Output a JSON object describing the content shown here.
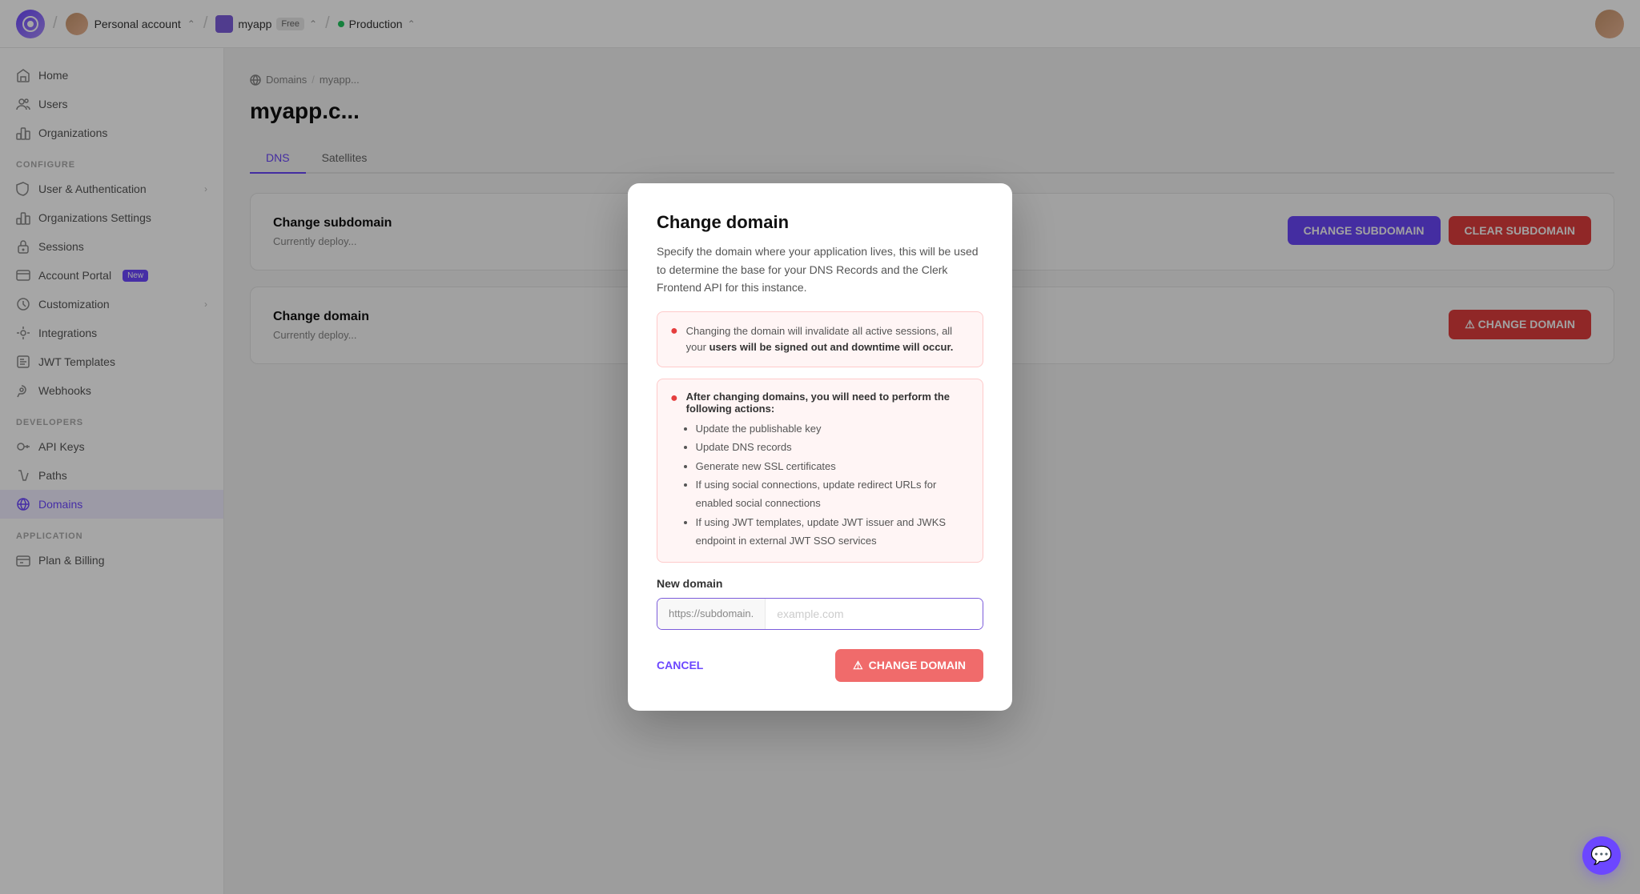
{
  "topbar": {
    "logo_letter": "C",
    "account_name": "Personal account",
    "app_name": "myapp",
    "app_badge": "Free",
    "env_name": "Production"
  },
  "sidebar": {
    "sections": [
      {
        "items": [
          {
            "id": "home",
            "label": "Home",
            "icon": "home"
          },
          {
            "id": "users",
            "label": "Users",
            "icon": "users"
          },
          {
            "id": "organizations",
            "label": "Organizations",
            "icon": "org"
          }
        ]
      },
      {
        "section_label": "Configure",
        "items": [
          {
            "id": "user-auth",
            "label": "User & Authentication",
            "icon": "shield",
            "has_chevron": true
          },
          {
            "id": "org-settings",
            "label": "Organizations Settings",
            "icon": "org-settings"
          },
          {
            "id": "sessions",
            "label": "Sessions",
            "icon": "lock"
          },
          {
            "id": "account-portal",
            "label": "Account Portal",
            "icon": "account-portal",
            "badge": "New"
          },
          {
            "id": "customization",
            "label": "Customization",
            "icon": "customization",
            "has_chevron": true
          },
          {
            "id": "integrations",
            "label": "Integrations",
            "icon": "integrations"
          },
          {
            "id": "jwt-templates",
            "label": "JWT Templates",
            "icon": "jwt"
          },
          {
            "id": "webhooks",
            "label": "Webhooks",
            "icon": "webhooks"
          }
        ]
      },
      {
        "section_label": "Developers",
        "items": [
          {
            "id": "api-keys",
            "label": "API Keys",
            "icon": "api-key"
          },
          {
            "id": "paths",
            "label": "Paths",
            "icon": "paths"
          },
          {
            "id": "domains",
            "label": "Domains",
            "icon": "domains",
            "active": true
          }
        ]
      },
      {
        "section_label": "Application",
        "items": [
          {
            "id": "plan-billing",
            "label": "Plan & Billing",
            "icon": "billing"
          }
        ]
      }
    ]
  },
  "content": {
    "breadcrumb": [
      "Domains",
      "myapp..."
    ],
    "page_title": "myapp.c...",
    "tabs": [
      "DNS",
      "Satellites"
    ],
    "change_subdomain": {
      "title": "Change subdomain",
      "description": "Currently deploy...",
      "btn_change": "CHANGE SUBDOMAIN",
      "btn_clear": "CLEAR SUBDOMAIN"
    },
    "change_domain": {
      "title": "Change domain",
      "description": "Currently deploy...",
      "btn_change": "CHANGE DOMAIN"
    }
  },
  "modal": {
    "title": "Change domain",
    "description": "Specify the domain where your application lives, this will be used to determine the base for your DNS Records and the Clerk Frontend API for this instance.",
    "warning1": {
      "text": "Changing the domain will invalidate all active sessions, all your",
      "strong": "users will be signed out and downtime will occur."
    },
    "warning2": {
      "title": "After changing domains, you will need to perform the following actions:",
      "items": [
        "Update the publishable key",
        "Update DNS records",
        "Generate new SSL certificates",
        "If using social connections, update redirect URLs for enabled social connections",
        "If using JWT templates, update JWT issuer and JWKS endpoint in external JWT SSO services"
      ]
    },
    "new_domain_label": "New domain",
    "domain_prefix": "https://subdomain.",
    "domain_input_placeholder": "example.com",
    "cancel_label": "CANCEL",
    "change_domain_label": "CHANGE DOMAIN"
  }
}
